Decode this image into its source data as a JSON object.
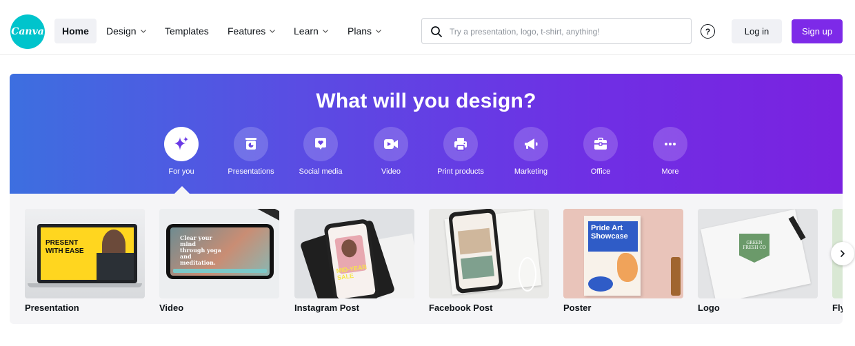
{
  "nav": {
    "logo_text": "Canva",
    "items": [
      {
        "label": "Home",
        "active": true,
        "dropdown": false
      },
      {
        "label": "Design",
        "active": false,
        "dropdown": true
      },
      {
        "label": "Templates",
        "active": false,
        "dropdown": false
      },
      {
        "label": "Features",
        "active": false,
        "dropdown": true
      },
      {
        "label": "Learn",
        "active": false,
        "dropdown": true
      },
      {
        "label": "Plans",
        "active": false,
        "dropdown": true
      }
    ],
    "search_placeholder": "Try a presentation, logo, t-shirt, anything!",
    "help_icon": "question-circle-icon",
    "help_glyph": "?",
    "login_label": "Log in",
    "signup_label": "Sign up"
  },
  "hero": {
    "title": "What will you design?",
    "categories": [
      {
        "label": "For you",
        "icon": "sparkle-icon",
        "active": true
      },
      {
        "label": "Presentations",
        "icon": "presentation-icon",
        "active": false
      },
      {
        "label": "Social media",
        "icon": "heart-chat-icon",
        "active": false
      },
      {
        "label": "Video",
        "icon": "video-camera-icon",
        "active": false
      },
      {
        "label": "Print products",
        "icon": "printer-icon",
        "active": false
      },
      {
        "label": "Marketing",
        "icon": "megaphone-icon",
        "active": false
      },
      {
        "label": "Office",
        "icon": "briefcase-icon",
        "active": false
      },
      {
        "label": "More",
        "icon": "more-dots-icon",
        "active": false
      }
    ]
  },
  "templates": {
    "items": [
      {
        "label": "Presentation",
        "thumb_text": "PRESENT\nWITH EASE"
      },
      {
        "label": "Video",
        "thumb_text": "Clear your mind through yoga and meditation."
      },
      {
        "label": "Instagram Post",
        "thumb_text": "MID-YEAR SALE"
      },
      {
        "label": "Facebook Post",
        "thumb_text": ""
      },
      {
        "label": "Poster",
        "thumb_text": "Pride Art Showcase"
      },
      {
        "label": "Logo",
        "thumb_text": "GREEN FRESH CO"
      },
      {
        "label": "Flyer",
        "thumb_text": ""
      }
    ],
    "next_icon": "chevron-right-icon"
  },
  "colors": {
    "brand_teal": "#00c4cc",
    "accent_purple": "#7d2ae8",
    "hero_gradient_start": "#3d6fe0",
    "hero_gradient_end": "#7a22e0"
  }
}
